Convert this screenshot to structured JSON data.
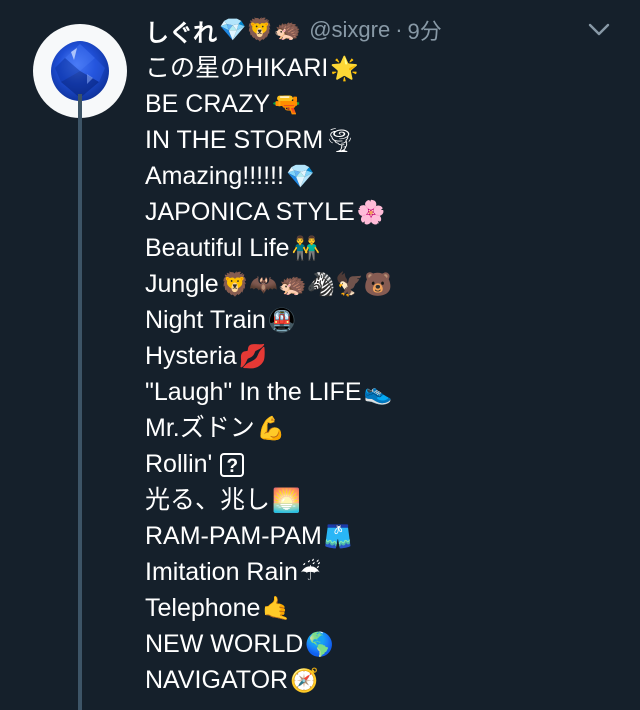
{
  "tweet": {
    "display_name": "しぐれ",
    "name_emoji": "💎🦁🦔",
    "handle": "@sixgre",
    "separator": "·",
    "time": "9分",
    "lines": [
      {
        "text": "この星のHIKARI",
        "emoji": "🌟"
      },
      {
        "text": "BE CRAZY",
        "emoji": "🔫"
      },
      {
        "text": "IN THE STORM",
        "emoji": "🌪"
      },
      {
        "text": "Amazing!!!!!!",
        "emoji": "💎"
      },
      {
        "text": "JAPONICA STYLE",
        "emoji": "🌸"
      },
      {
        "text": "Beautiful Life",
        "emoji": "👬"
      },
      {
        "text": "Jungle",
        "emoji": "🦁🦇🦔🦓🦅🐻"
      },
      {
        "text": "Night Train",
        "emoji": "🚇"
      },
      {
        "text": "Hysteria",
        "emoji": "💋"
      },
      {
        "text": "\"Laugh\" In the LIFE",
        "emoji": "👟"
      },
      {
        "text": "Mr.ズドン",
        "emoji": "💪"
      },
      {
        "text": "Rollin'",
        "emoji": "?"
      },
      {
        "text": "光る、兆し",
        "emoji": "🌅"
      },
      {
        "text": "RAM-PAM-PAM",
        "emoji": "🩳"
      },
      {
        "text": "Imitation Rain",
        "emoji": "☔"
      },
      {
        "text": "Telephone",
        "emoji": "🤙"
      },
      {
        "text": "NEW WORLD",
        "emoji": "🌎"
      },
      {
        "text": "NAVIGATOR",
        "emoji": "🧭"
      }
    ]
  },
  "icons": {
    "avatar": "blue-sapphire-gem-icon",
    "menu": "chevron-down-icon"
  },
  "colors": {
    "background": "#15202b",
    "secondary_text": "#8899a6",
    "thread_line": "#3d5466",
    "gem_blue": "#1f4fd6"
  }
}
